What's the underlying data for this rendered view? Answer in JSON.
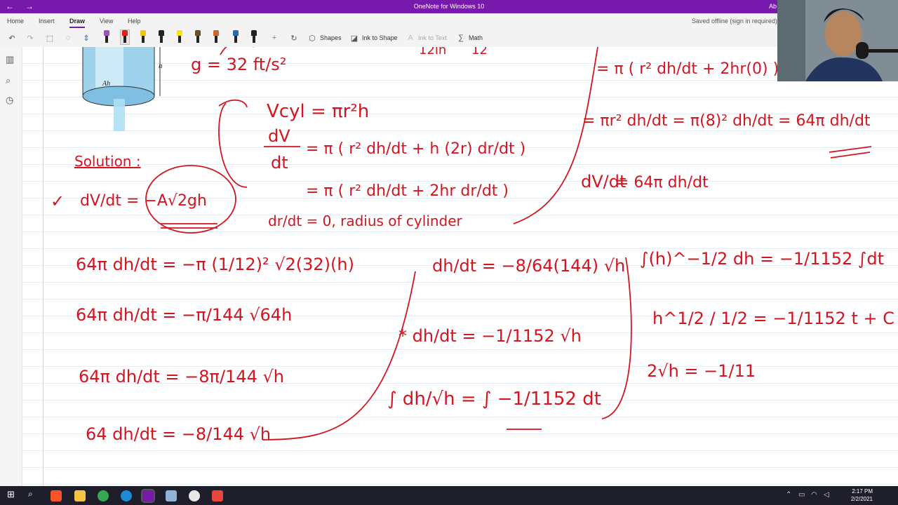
{
  "window": {
    "title": "OneNote for Windows 10",
    "user_initial": "Ab",
    "back_icon": "back-arrow-icon",
    "forward_icon": "forward-arrow-icon"
  },
  "menu": {
    "tabs": [
      "Home",
      "Insert",
      "Draw",
      "View",
      "Help"
    ],
    "active_tab": "Draw",
    "status": "Saved offline (sign in required)"
  },
  "toolbar": {
    "shapes": "Shapes",
    "ink_to_shape": "Ink to Shape",
    "ink_to_text": "Ink to Text",
    "math": "Math",
    "pen_colors": [
      "#9b59b6",
      "#e02020",
      "#f2c511",
      "#222222",
      "#f2e611",
      "#6b4f2a",
      "#c46a2d",
      "#2b6cb0",
      "#222222"
    ],
    "selected_pen": 1
  },
  "notes": {
    "ink_color": "#d4151f",
    "g_eq": "g = 32 ft/s²",
    "top_frag1": "12in",
    "top_frag2": "12",
    "solution": "Solution :",
    "dvdt": "dV/dt = −A√2gh",
    "vcyl": "Vcyl = πr²h",
    "dv_line1_lhs": "dV",
    "dv_line1_den": "dt",
    "dv_line1_rhs": "= π ( r² dh/dt + h (2r) dr/dt )",
    "dv_line2": "= π ( r² dh/dt + 2hr dr/dt )",
    "drdt": "dr/dt = 0, radius of cylinder",
    "r_top": "= π ( r² dh/dt + 2hr(0) )",
    "r_dv1": "= πr² dh/dt = π(8)² dh/dt = 64π dh/dt",
    "r_dv2": "= 64π dh/dt",
    "l1": "64π dh/dt = −π (1/12)² √2(32)(h)",
    "l2": "64π dh/dt = −π/144 √64h",
    "l3": "64π dh/dt = −8π/144 √h",
    "l4": "64 dh/dt = −8/144 √h",
    "m1": "dh/dt = −8/64(144) √h",
    "m2": "* dh/dt = −1/1152 √h",
    "m3": "∫ dh/√h = ∫ −1/1152 dt",
    "r1": "∫(h)^−1/2 dh = −1/1152 ∫dt",
    "r2": "h^1/2 / 1/2 = −1/1152 t + C",
    "r3": "2√h = −1/11"
  },
  "taskbar": {
    "time": "2:17 PM",
    "date": "2/2/2021"
  }
}
